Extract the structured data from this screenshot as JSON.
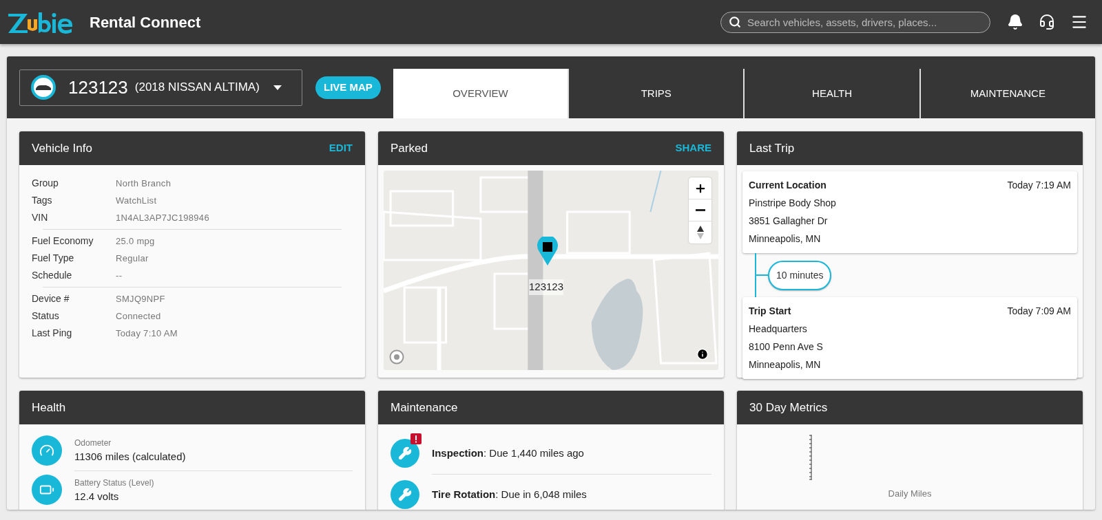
{
  "header": {
    "app_name": "Rental Connect",
    "search": {
      "placeholder": "Search vehicles, assets, drivers, places..."
    }
  },
  "vehicle_selector": {
    "number": "123123",
    "model": "(2018 NISSAN ALTIMA)"
  },
  "live_map_button": "LIVE MAP",
  "tabs": [
    {
      "label": "OVERVIEW",
      "selected": true
    },
    {
      "label": "TRIPS",
      "selected": false
    },
    {
      "label": "HEALTH",
      "selected": false
    },
    {
      "label": "MAINTENANCE",
      "selected": false
    }
  ],
  "vehicle_info": {
    "title": "Vehicle Info",
    "action": "EDIT",
    "groups": [
      [
        {
          "label": "Group",
          "value": "North Branch"
        },
        {
          "label": "Tags",
          "value": "WatchList"
        },
        {
          "label": "VIN",
          "value": "1N4AL3AP7JC198946"
        }
      ],
      [
        {
          "label": "Fuel Economy",
          "value": "25.0 mpg"
        },
        {
          "label": "Fuel Type",
          "value": "Regular"
        },
        {
          "label": "Schedule",
          "value": "--"
        }
      ],
      [
        {
          "label": "Device #",
          "value": "SMJQ9NPF"
        },
        {
          "label": "Status",
          "value": "Connected"
        },
        {
          "label": "Last Ping",
          "value": "Today 7:10 AM"
        }
      ]
    ]
  },
  "parked": {
    "title": "Parked",
    "action": "SHARE",
    "map": {
      "kind": "picture",
      "marker_label": "123123"
    }
  },
  "last_trip": {
    "title": "Last Trip",
    "stops": [
      {
        "title": "Current Location",
        "time": "Today 7:19 AM",
        "lines": [
          "Pinstripe Body Shop",
          "3851 Gallagher Dr",
          "Minneapolis, MN"
        ]
      },
      {
        "title": "Trip Start",
        "time": "Today 7:09 AM",
        "lines": [
          "Headquarters",
          "8100 Penn Ave S",
          "Minneapolis, MN"
        ]
      }
    ],
    "duration": "10 minutes"
  },
  "health": {
    "title": "Health",
    "items": [
      {
        "kind": "odometer",
        "label": "Odometer",
        "value": "11306 miles (calculated)"
      },
      {
        "kind": "battery",
        "label": "Battery Status (Level)",
        "value": "12.4 volts"
      }
    ]
  },
  "maintenance": {
    "title": "Maintenance",
    "items": [
      {
        "text": "**Inspection**: Due 1,440 miles ago",
        "alert": true
      },
      {
        "text": "**Tire Rotation**: Due in 6,048 miles",
        "alert": false
      }
    ]
  },
  "metrics": {
    "title": "30 Day Metrics",
    "chart_label": "Daily Miles"
  }
}
